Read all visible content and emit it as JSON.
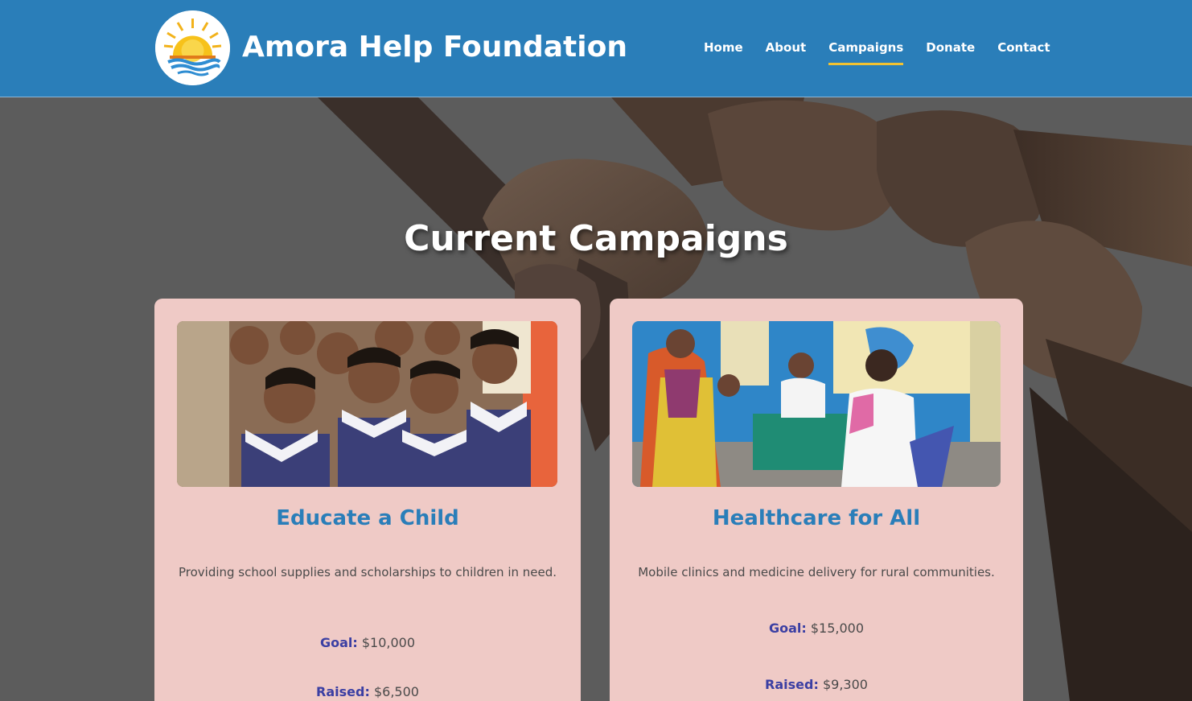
{
  "site": {
    "title": "Amora Help Foundation",
    "logo_icon": "sun-over-water-logo",
    "header_color": "#2a7eb9",
    "accent_color": "#f1c232"
  },
  "nav": {
    "items": [
      {
        "label": "Home",
        "active": false
      },
      {
        "label": "About",
        "active": false
      },
      {
        "label": "Campaigns",
        "active": true
      },
      {
        "label": "Donate",
        "active": false
      },
      {
        "label": "Contact",
        "active": false
      }
    ]
  },
  "hero": {
    "background": "hands-in-circle-photo",
    "title": "Current Campaigns"
  },
  "campaigns": [
    {
      "image": "schoolchildren-photo",
      "title": "Educate a Child",
      "description": "Providing school supplies and scholarships to children in need.",
      "goal_label": "Goal:",
      "goal_value": "$10,000",
      "raised_label": "Raised:",
      "raised_value": "$6,500"
    },
    {
      "image": "mobile-clinic-photo",
      "title": "Healthcare for All",
      "description": "Mobile clinics and medicine delivery for rural communities.",
      "goal_label": "Goal:",
      "goal_value": "$15,000",
      "raised_label": "Raised:",
      "raised_value": "$9,300"
    }
  ]
}
